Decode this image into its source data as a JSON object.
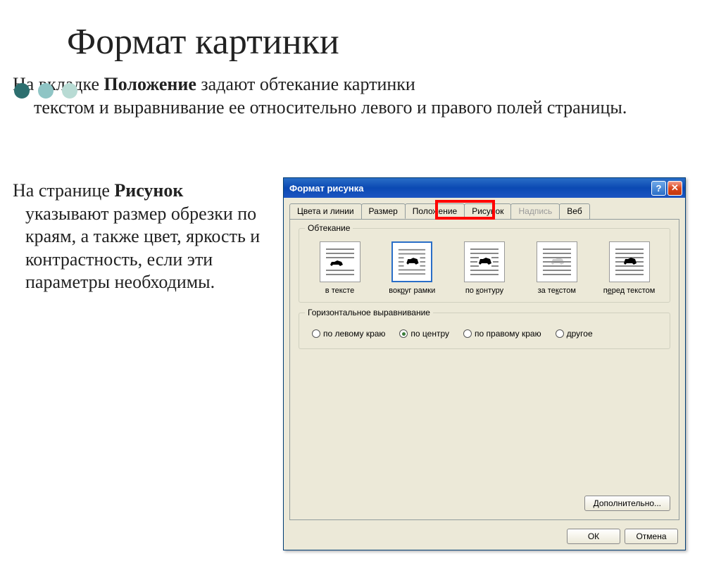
{
  "slide": {
    "title": "Формат картинки",
    "para1_prefix": "На вкладке ",
    "para1_bold": "Положение",
    "para1_suffix": " задают обтекание картинки",
    "para1_line2": "текстом и выравнивание ее относительно левого и правого полей страницы.",
    "para2_prefix": "На странице ",
    "para2_bold": "Рисунок",
    "para2_lines": "указывают размер обрезки по краям, а также цвет, яркость и контрастность, если эти параметры необходимы."
  },
  "dialog": {
    "title": "Формат рисунка",
    "tabs": {
      "colors": "Цвета и линии",
      "size": "Размер",
      "position": "Положение",
      "picture": "Рисунок",
      "caption": "Надпись",
      "web": "Веб"
    },
    "wrap": {
      "group_title": "Обтекание",
      "opt1": "в тексте",
      "opt2_pre": "вок",
      "opt2_u": "р",
      "opt2_post": "уг рамки",
      "opt3_pre": "по ",
      "opt3_u": "к",
      "opt3_post": "онтуру",
      "opt4_pre": "за те",
      "opt4_u": "к",
      "opt4_post": "стом",
      "opt5_pre": "п",
      "opt5_u": "е",
      "opt5_post": "ред текстом"
    },
    "align": {
      "group_title": "Горизонтальное выравнивание",
      "left": "по левому краю",
      "center": "по центру",
      "right": "по правому краю",
      "other": "другое"
    },
    "buttons": {
      "extra": "Дополнительно...",
      "ok": "ОК",
      "cancel": "Отмена"
    }
  }
}
